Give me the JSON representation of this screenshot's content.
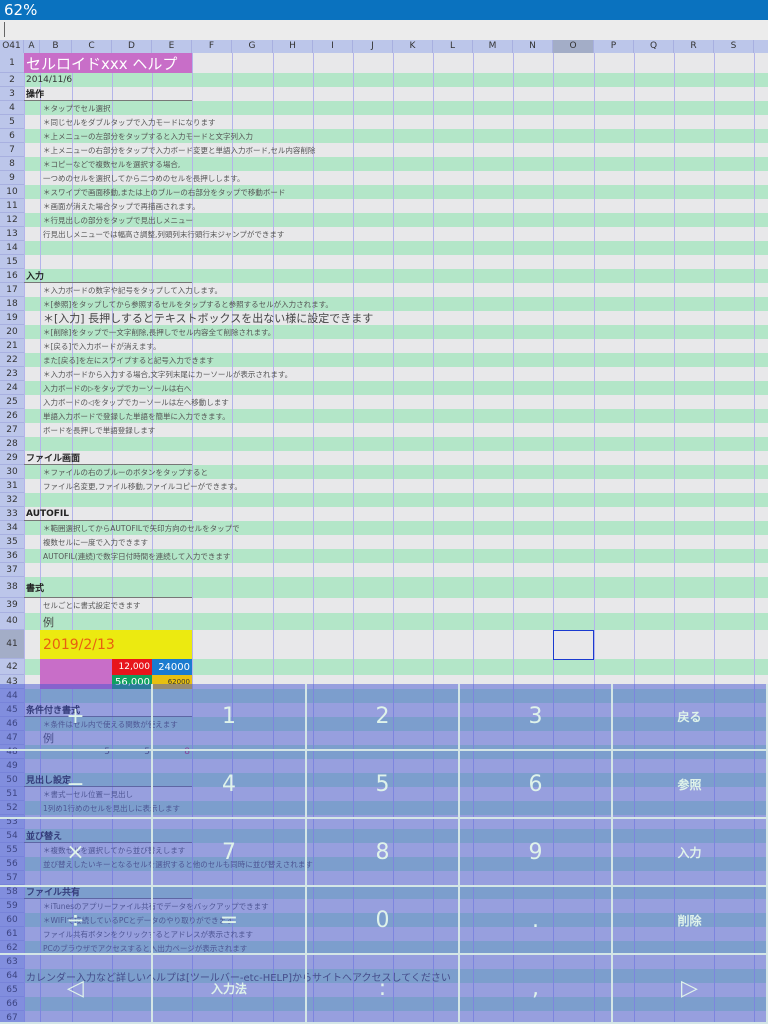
{
  "status_bar": {
    "zoom": "62%"
  },
  "formula_bar": {
    "value": ""
  },
  "name_box": "O41",
  "columns": [
    "A",
    "B",
    "C",
    "D",
    "E",
    "F",
    "G",
    "H",
    "I",
    "J",
    "K",
    "L",
    "M",
    "N",
    "O",
    "P",
    "Q",
    "R",
    "S",
    ""
  ],
  "selected_cell": {
    "column": "O",
    "row": 41
  },
  "cells": [
    {
      "row": 1,
      "col": "A",
      "text": "セルロイドxxx ヘルプ",
      "style": "title",
      "span": 5
    },
    {
      "row": 2,
      "col": "A",
      "text": "2014/11/6",
      "style": "date",
      "span": 3
    },
    {
      "row": 3,
      "col": "A",
      "text": "操作",
      "style": "head",
      "span": 5
    },
    {
      "row": 4,
      "col": "B",
      "text": "＊タップでセル選択",
      "style": "body"
    },
    {
      "row": 5,
      "col": "B",
      "text": "＊同じセルをダブルタップで入力モードになります",
      "style": "body"
    },
    {
      "row": 6,
      "col": "B",
      "text": "＊上メニューの左部分をタップすると入力モードと文字列入力",
      "style": "body"
    },
    {
      "row": 7,
      "col": "B",
      "text": "＊上メニューの右部分をタップで入力ボード変更と単語入力ボード,セル内容削除",
      "style": "body"
    },
    {
      "row": 8,
      "col": "B",
      "text": "＊コピーなどで複数セルを選択する場合,",
      "style": "body"
    },
    {
      "row": 9,
      "col": "B",
      "text": "一つめのセルを選択してから二つめのセルを長押しします。",
      "style": "body"
    },
    {
      "row": 10,
      "col": "B",
      "text": "＊スワイプで画面移動,または上のブルーの右部分をタップで移動ボード",
      "style": "body"
    },
    {
      "row": 11,
      "col": "B",
      "text": "＊画面が消えた場合タップで再描画されます。",
      "style": "body"
    },
    {
      "row": 12,
      "col": "B",
      "text": "＊行見出しの部分をタップで見出しメニュー",
      "style": "body"
    },
    {
      "row": 13,
      "col": "B",
      "text": "行見出しメニューでは幅高さ調整,列頭列末行頭行末ジャンプができます",
      "style": "body"
    },
    {
      "row": 16,
      "col": "A",
      "text": "入力",
      "style": "head",
      "span": 5
    },
    {
      "row": 17,
      "col": "B",
      "text": "＊入力ボードの数字や記号をタップして入力します。",
      "style": "body"
    },
    {
      "row": 18,
      "col": "B",
      "text": "＊[参照]をタップしてから参照するセルをタップすると参照するセルが入力されます。",
      "style": "body"
    },
    {
      "row": 19,
      "col": "B",
      "text": "＊[入力] 長押しするとテキストボックスを出ない様に設定できます",
      "style": "big"
    },
    {
      "row": 20,
      "col": "B",
      "text": "＊[削除]をタップで一文字削除,長押しでセル内容全て削除されます。",
      "style": "body"
    },
    {
      "row": 21,
      "col": "B",
      "text": "＊[戻る]で入力ボードが消えます。",
      "style": "body"
    },
    {
      "row": 22,
      "col": "B",
      "text": "また[戻る]を左にスワイプすると記号入力できます",
      "style": "body"
    },
    {
      "row": 23,
      "col": "B",
      "text": "＊入力ボードから入力する場合,文字列末尾にカーソールが表示されます。",
      "style": "body"
    },
    {
      "row": 24,
      "col": "B",
      "text": "入力ボードの▷をタップでカーソールは右へ",
      "style": "body"
    },
    {
      "row": 25,
      "col": "B",
      "text": "入力ボードの◁をタップでカーソールは左へ移動します",
      "style": "body"
    },
    {
      "row": 26,
      "col": "B",
      "text": "単語入力ボードで登録した単語を簡単に入力できます。",
      "style": "body"
    },
    {
      "row": 27,
      "col": "B",
      "text": "ボードを長押しで単語登録します",
      "style": "body"
    },
    {
      "row": 29,
      "col": "A",
      "text": "ファイル画面",
      "style": "head",
      "span": 5
    },
    {
      "row": 30,
      "col": "B",
      "text": "＊ファイルの右のブルーのボタンをタップすると",
      "style": "body"
    },
    {
      "row": 31,
      "col": "B",
      "text": "ファイル名変更,ファイル移動,ファイルコピーができます。",
      "style": "body"
    },
    {
      "row": 33,
      "col": "A",
      "text": "AUTOFIL",
      "style": "head",
      "span": 5
    },
    {
      "row": 34,
      "col": "B",
      "text": "＊範囲選択してからAUTOFILで矢印方向のセルをタップで",
      "style": "body"
    },
    {
      "row": 35,
      "col": "B",
      "text": "複数セルに一度で入力できます",
      "style": "body"
    },
    {
      "row": 36,
      "col": "B",
      "text": "AUTOFIL(連続)で数字日付時間を連続して入力できます",
      "style": "body"
    },
    {
      "row": 38,
      "col": "A",
      "text": "書式",
      "style": "head",
      "span": 5
    },
    {
      "row": 39,
      "col": "B",
      "text": "セルごとに書式設定できます",
      "style": "body"
    },
    {
      "row": 40,
      "col": "B",
      "text": "例",
      "style": "big"
    },
    {
      "row": 41,
      "col": "B",
      "text": "2019/2/13",
      "style": "bigdate",
      "span": 4
    },
    {
      "row": 42,
      "col": "B",
      "text": "",
      "style": "mag",
      "span": 2
    },
    {
      "row": 42,
      "col": "D",
      "text": "12,000",
      "style": "red"
    },
    {
      "row": 42,
      "col": "E",
      "text": "24000",
      "style": "blue"
    },
    {
      "row": 43,
      "col": "B",
      "text": "",
      "style": "mag",
      "span": 2
    },
    {
      "row": 43,
      "col": "D",
      "text": "56,000",
      "style": "green"
    },
    {
      "row": 43,
      "col": "E",
      "text": "62000",
      "style": "yel"
    },
    {
      "row": 45,
      "col": "A",
      "text": "条件付き書式",
      "style": "head",
      "span": 5
    },
    {
      "row": 46,
      "col": "B",
      "text": "＊条件はセル内で使える関数が使えます",
      "style": "body"
    },
    {
      "row": 47,
      "col": "B",
      "text": "例",
      "style": "big"
    },
    {
      "row": 48,
      "col": "C",
      "text": "5",
      "style": "num"
    },
    {
      "row": 48,
      "col": "D",
      "text": "5",
      "style": "num"
    },
    {
      "row": 48,
      "col": "E",
      "text": "8",
      "style": "numr"
    },
    {
      "row": 50,
      "col": "A",
      "text": "見出し設定",
      "style": "head",
      "span": 5
    },
    {
      "row": 51,
      "col": "B",
      "text": "＊書式ーセル位置ー見出し",
      "style": "body"
    },
    {
      "row": 52,
      "col": "B",
      "text": "1列め1行めのセルを見出しに表示します",
      "style": "body"
    },
    {
      "row": 54,
      "col": "A",
      "text": "並び替え",
      "style": "head",
      "span": 5
    },
    {
      "row": 55,
      "col": "B",
      "text": "＊複数セルを選択してから並び替えします",
      "style": "body"
    },
    {
      "row": 56,
      "col": "B",
      "text": "並び替えしたいキーとなるセルを選択すると他のセルも同時に並び替えされます",
      "style": "body"
    },
    {
      "row": 58,
      "col": "A",
      "text": "ファイル共有",
      "style": "head",
      "span": 5
    },
    {
      "row": 59,
      "col": "B",
      "text": "＊iTunesのアプリーファイル共有でデータをバックアップできます",
      "style": "body"
    },
    {
      "row": 60,
      "col": "B",
      "text": "＊WIFIで接続しているPCとデータのやり取りができます",
      "style": "body"
    },
    {
      "row": 61,
      "col": "B",
      "text": "ファイル共有ボタンをクリックするとアドレスが表示されます",
      "style": "body"
    },
    {
      "row": 62,
      "col": "B",
      "text": "PCのブラウザでアクセスすると入出力ページが表示されます",
      "style": "body"
    },
    {
      "row": 64,
      "col": "A",
      "text": "カレンダー入力など詳しいヘルプは[ツールバー-etc-HELP]からサイトへアクセスしてください",
      "style": "foot"
    }
  ],
  "keyboard": {
    "rows": [
      [
        {
          "label": "+",
          "name": "plus"
        },
        {
          "label": "1",
          "name": "1"
        },
        {
          "label": "2",
          "name": "2"
        },
        {
          "label": "3",
          "name": "3"
        },
        {
          "label": "戻る",
          "name": "back",
          "txt": true
        }
      ],
      [
        {
          "label": "−",
          "name": "minus"
        },
        {
          "label": "4",
          "name": "4"
        },
        {
          "label": "5",
          "name": "5"
        },
        {
          "label": "6",
          "name": "6"
        },
        {
          "label": "参照",
          "name": "reference",
          "txt": true
        }
      ],
      [
        {
          "label": "×",
          "name": "multiply"
        },
        {
          "label": "7",
          "name": "7"
        },
        {
          "label": "8",
          "name": "8"
        },
        {
          "label": "9",
          "name": "9"
        },
        {
          "label": "入力",
          "name": "enter",
          "txt": true
        }
      ],
      [
        {
          "label": "÷",
          "name": "divide"
        },
        {
          "label": "=",
          "name": "equals"
        },
        {
          "label": "0",
          "name": "0"
        },
        {
          "label": ".",
          "name": "period"
        },
        {
          "label": "削除",
          "name": "delete",
          "txt": true
        }
      ],
      [
        {
          "label": "◁",
          "name": "cursor-left"
        },
        {
          "label": "入力法",
          "name": "input-method",
          "txt": true
        },
        {
          "label": ":",
          "name": "colon"
        },
        {
          "label": ",",
          "name": "comma"
        },
        {
          "label": "▷",
          "name": "cursor-right"
        }
      ]
    ]
  }
}
